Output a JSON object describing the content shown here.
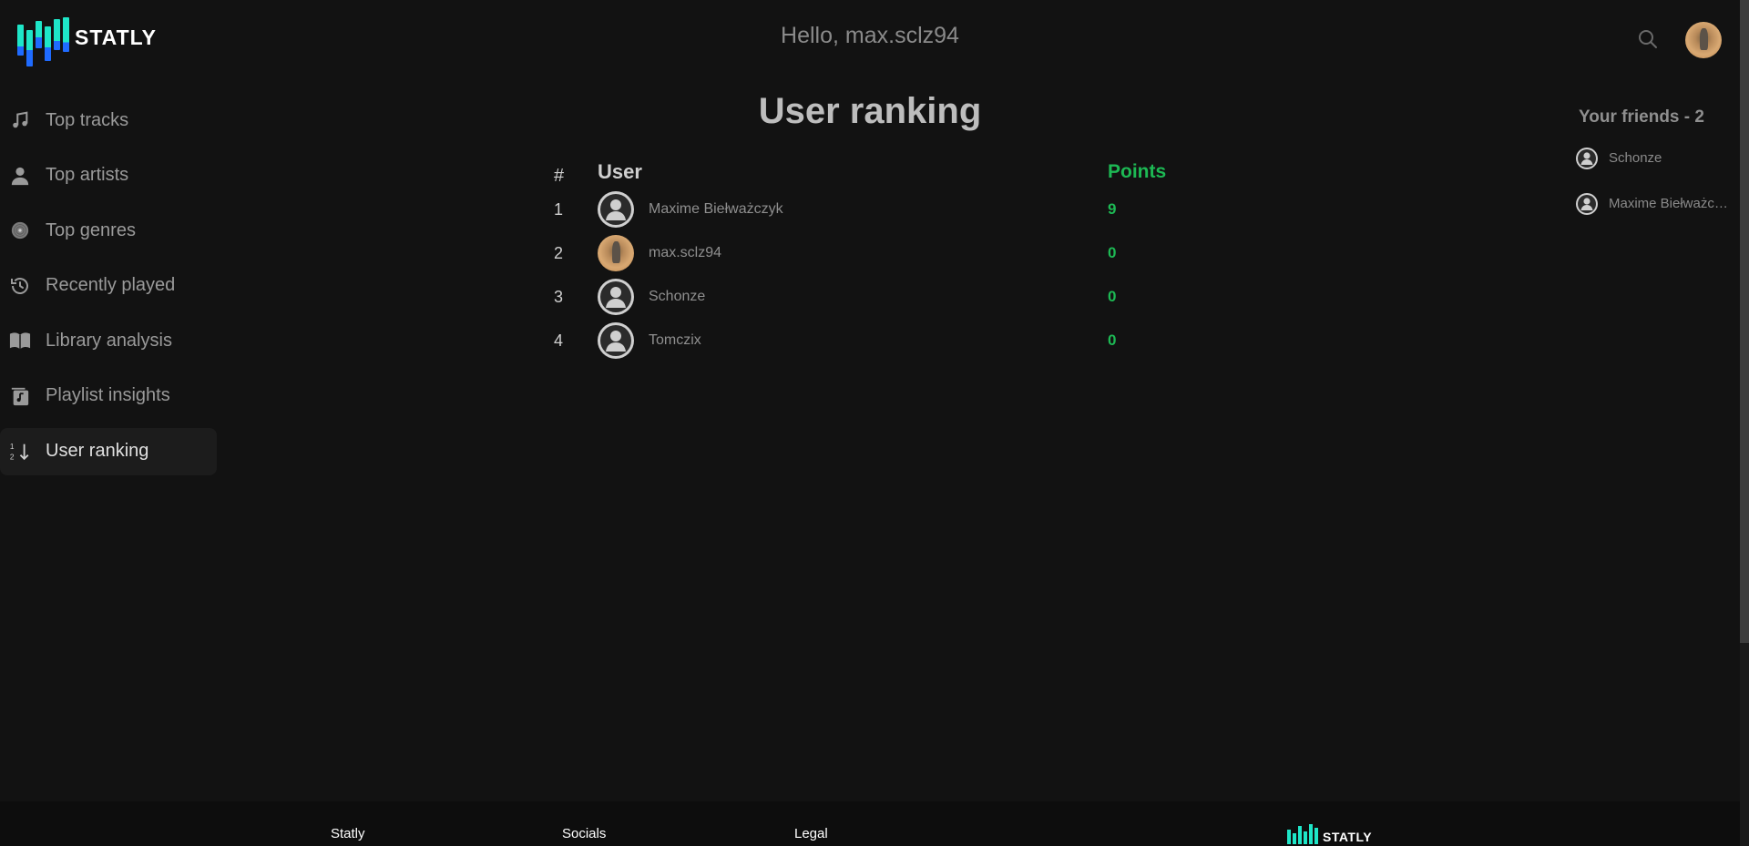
{
  "app": {
    "brand": "STATLY",
    "greeting": "Hello, max.sclz94"
  },
  "colors": {
    "background": "#121212",
    "accent_green": "#1db954",
    "logo_teal": "#1ee6c8",
    "logo_blue": "#1f6bff"
  },
  "header": {
    "search_icon": "search-icon",
    "avatar": "user-avatar-photo"
  },
  "sidebar": {
    "items": [
      {
        "label": "Top tracks",
        "icon": "music-note-icon",
        "active": false
      },
      {
        "label": "Top artists",
        "icon": "person-icon",
        "active": false
      },
      {
        "label": "Top genres",
        "icon": "vinyl-icon",
        "active": false
      },
      {
        "label": "Recently played",
        "icon": "history-icon",
        "active": false
      },
      {
        "label": "Library analysis",
        "icon": "book-icon",
        "active": false
      },
      {
        "label": "Playlist insights",
        "icon": "playlist-icon",
        "active": false
      },
      {
        "label": "User ranking",
        "icon": "sort-numeric-icon",
        "active": true
      }
    ]
  },
  "main": {
    "title": "User ranking",
    "table": {
      "headers": {
        "rank": "#",
        "user": "User",
        "points": "Points"
      },
      "rows": [
        {
          "rank": "1",
          "name": "Maxime Biełważczyk",
          "points": "9",
          "avatar": "default"
        },
        {
          "rank": "2",
          "name": "max.sclz94",
          "points": "0",
          "avatar": "photo"
        },
        {
          "rank": "3",
          "name": "Schonze",
          "points": "0",
          "avatar": "default"
        },
        {
          "rank": "4",
          "name": "Tomczix",
          "points": "0",
          "avatar": "default"
        }
      ]
    }
  },
  "friends": {
    "title": "Your friends - 2",
    "items": [
      {
        "name": "Schonze"
      },
      {
        "name": "Maxime Biełważczyk"
      }
    ]
  },
  "footer": {
    "col1": "Statly",
    "col2": "Socials",
    "col3": "Legal",
    "brand": "STATLY"
  }
}
